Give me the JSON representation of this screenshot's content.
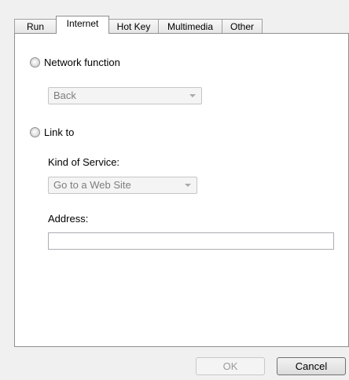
{
  "tabs": [
    {
      "label": "Run"
    },
    {
      "label": "Internet",
      "active": true
    },
    {
      "label": "Hot Key"
    },
    {
      "label": "Multimedia"
    },
    {
      "label": "Other"
    }
  ],
  "network_function": {
    "label": "Network function",
    "selected": false,
    "combo_value": "Back"
  },
  "link_to": {
    "label": "Link to",
    "selected": false,
    "kind_label": "Kind of Service:",
    "kind_value": "Go to a Web Site",
    "address_label": "Address:",
    "address_value": ""
  },
  "buttons": {
    "ok": "OK",
    "cancel": "Cancel"
  }
}
